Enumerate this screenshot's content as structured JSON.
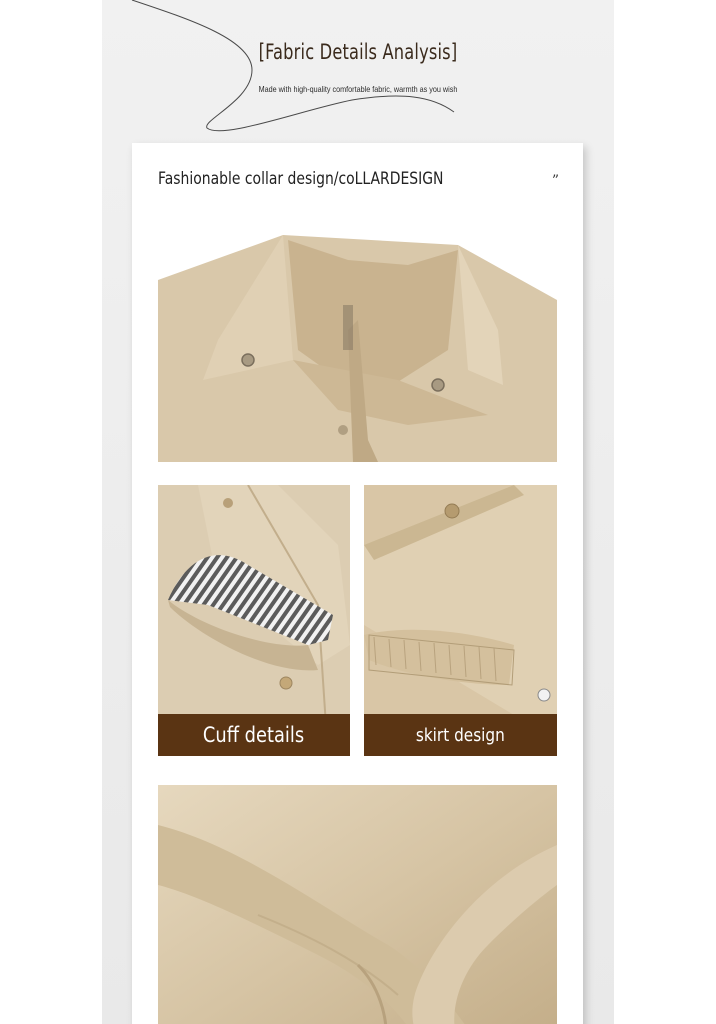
{
  "header": {
    "title": "[Fabric Details Analysis]",
    "subtitle": "Made with high-quality comfortable fabric, warmth as you wish"
  },
  "card": {
    "title": "Fashionable collar design/coLLARDESIGN",
    "quote_mark": "”"
  },
  "photos": {
    "cuff_caption": "Cuff details",
    "skirt_caption": "skirt design"
  },
  "colors": {
    "caption_bar": "#5a3413",
    "fabric_khaki": "#d8c7a9",
    "page_background": "#eeeeee"
  }
}
